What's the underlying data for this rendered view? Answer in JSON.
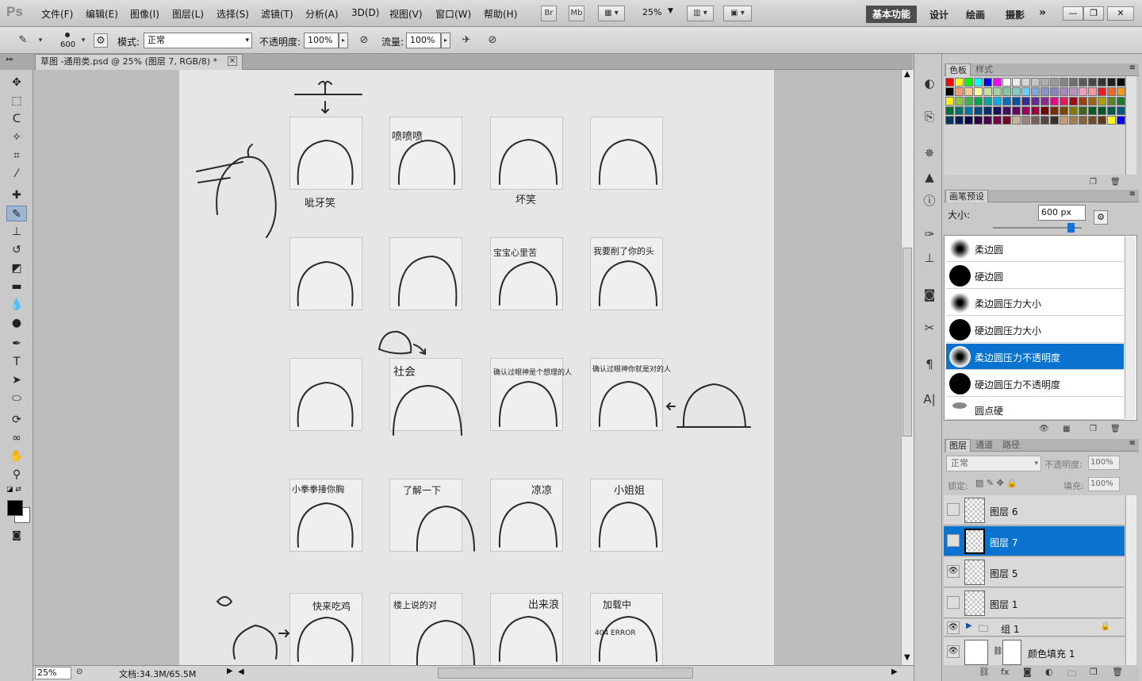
{
  "app": {
    "logo": "Ps"
  },
  "menu": [
    "文件(F)",
    "编辑(E)",
    "图像(I)",
    "图层(L)",
    "选择(S)",
    "滤镜(T)",
    "分析(A)",
    "3D(D)",
    "视图(V)",
    "窗口(W)",
    "帮助(H)"
  ],
  "menubar_buttons": {
    "bridge": "Br",
    "minibridge": "Mb",
    "zoom": "25%"
  },
  "workspaces": {
    "active": "基本功能",
    "others": [
      "设计",
      "绘画",
      "摄影"
    ],
    "more": "»"
  },
  "window_controls": [
    "—",
    "❐",
    "✕"
  ],
  "options": {
    "brush_size": "600",
    "mode_label": "模式:",
    "mode_value": "正常",
    "opacity_label": "不透明度:",
    "opacity_value": "100%",
    "flow_label": "流量:",
    "flow_value": "100%"
  },
  "document": {
    "tab_title": "草图 -通用类.psd @ 25% (图层 7, RGB/8) *",
    "close": "×",
    "zoom": "25%",
    "info": "文档:34.3M/65.5M"
  },
  "canvas_text": [
    "呲牙笑",
    "喷喷喷",
    "坏笑",
    "宝宝心里苦",
    "我要削了你的头",
    "社会",
    "确认过眼神是个想理的人",
    "确认过眼神你就是对的人",
    "小拳拳捶你胸",
    "了解一下",
    "凉凉",
    "小姐姐",
    "快来吃鸡",
    "楼上说的对",
    "出来浪",
    "加载中",
    "404 ERROR"
  ],
  "swatches_panel": {
    "tabs": [
      "色板",
      "样式"
    ]
  },
  "swatch_colors": [
    "#ff0000",
    "#ffff00",
    "#00ff00",
    "#00ffff",
    "#0000ff",
    "#ff00ff",
    "#ffffff",
    "#ebebeb",
    "#d6d6d6",
    "#c2c2c2",
    "#adadad",
    "#999999",
    "#858585",
    "#707070",
    "#5c5c5c",
    "#474747",
    "#333333",
    "#1f1f1f",
    "#0a0a0a",
    "#000000",
    "#f7977a",
    "#fdc68a",
    "#fff79a",
    "#c4df9b",
    "#a2d39c",
    "#82ca9d",
    "#7bcdc8",
    "#6ecff6",
    "#7ea7d8",
    "#8493ca",
    "#8882be",
    "#a187be",
    "#bc8dbf",
    "#f49ac2",
    "#f6989d",
    "#ed1c24",
    "#f26522",
    "#f7941d",
    "#fff200",
    "#8dc63f",
    "#39b54a",
    "#00a651",
    "#00a99d",
    "#00aeef",
    "#0072bc",
    "#0054a6",
    "#2e3192",
    "#662d91",
    "#92278f",
    "#ec008c",
    "#ed145b",
    "#9e0b0f",
    "#a0410d",
    "#a3620a",
    "#aba000",
    "#598527",
    "#1a7b30",
    "#007236",
    "#00746b",
    "#0076a3",
    "#004b80",
    "#003471",
    "#1b1464",
    "#440e62",
    "#630460",
    "#9e005d",
    "#9e0039",
    "#790000",
    "#7b2e00",
    "#7d4900",
    "#827b00",
    "#406618",
    "#005e20",
    "#005826",
    "#005952",
    "#005b7f",
    "#003663",
    "#002157",
    "#0d004c",
    "#32004b",
    "#4b0049",
    "#7b0046",
    "#7a0026",
    "#c7b299",
    "#998675",
    "#736357",
    "#534741",
    "#37302a",
    "#c69c6d",
    "#a67c52",
    "#8c6239",
    "#754c24",
    "#603913",
    "#ffff00",
    "#0000ff"
  ],
  "brush_presets": {
    "tab": "画笔预设",
    "size_label": "大小:",
    "size_value": "600 px",
    "items": [
      "柔边圆",
      "硬边圆",
      "柔边圆压力大小",
      "硬边圆压力大小",
      "柔边圆压力不透明度",
      "硬边圆压力不透明度",
      "圆点硬"
    ],
    "selected_index": 4
  },
  "layers": {
    "tabs": [
      "图层",
      "通道",
      "路径"
    ],
    "blend": "正常",
    "opacity_label": "不透明度:",
    "opacity_value": "100%",
    "lock_label": "锁定:",
    "fill_label": "填充:",
    "fill_value": "100%",
    "items": [
      {
        "name": "图层 6",
        "visible": false,
        "selected": false
      },
      {
        "name": "图层 7",
        "visible": false,
        "selected": true
      },
      {
        "name": "图层 5",
        "visible": true,
        "selected": false
      },
      {
        "name": "图层 1",
        "visible": false,
        "selected": false
      }
    ],
    "group": "组 1",
    "fill_layer": "颜色填充 1"
  }
}
